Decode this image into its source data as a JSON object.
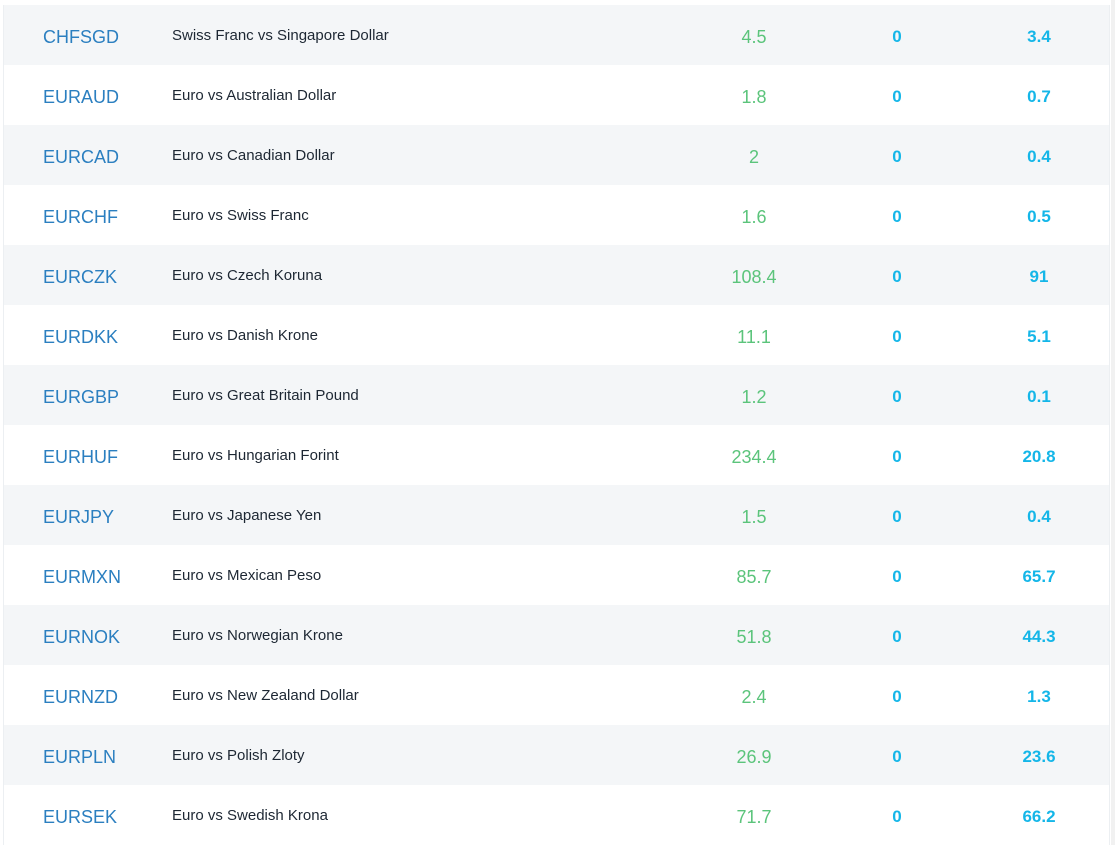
{
  "rows": [
    {
      "symbol": "CHFSGD",
      "description": "Swiss Franc vs Singapore Dollar",
      "spread": "4.5",
      "col3": "0",
      "col4": "3.4"
    },
    {
      "symbol": "EURAUD",
      "description": "Euro vs Australian Dollar",
      "spread": "1.8",
      "col3": "0",
      "col4": "0.7"
    },
    {
      "symbol": "EURCAD",
      "description": "Euro vs Canadian Dollar",
      "spread": "2",
      "col3": "0",
      "col4": "0.4"
    },
    {
      "symbol": "EURCHF",
      "description": "Euro vs Swiss Franc",
      "spread": "1.6",
      "col3": "0",
      "col4": "0.5"
    },
    {
      "symbol": "EURCZK",
      "description": "Euro vs Czech Koruna",
      "spread": "108.4",
      "col3": "0",
      "col4": "91"
    },
    {
      "symbol": "EURDKK",
      "description": "Euro vs Danish Krone",
      "spread": "11.1",
      "col3": "0",
      "col4": "5.1"
    },
    {
      "symbol": "EURGBP",
      "description": "Euro vs Great Britain Pound",
      "spread": "1.2",
      "col3": "0",
      "col4": "0.1"
    },
    {
      "symbol": "EURHUF",
      "description": "Euro vs Hungarian Forint",
      "spread": "234.4",
      "col3": "0",
      "col4": "20.8"
    },
    {
      "symbol": "EURJPY",
      "description": "Euro vs Japanese Yen",
      "spread": "1.5",
      "col3": "0",
      "col4": "0.4"
    },
    {
      "symbol": "EURMXN",
      "description": "Euro vs Mexican Peso",
      "spread": "85.7",
      "col3": "0",
      "col4": "65.7"
    },
    {
      "symbol": "EURNOK",
      "description": "Euro vs Norwegian Krone",
      "spread": "51.8",
      "col3": "0",
      "col4": "44.3"
    },
    {
      "symbol": "EURNZD",
      "description": "Euro vs New Zealand Dollar",
      "spread": "2.4",
      "col3": "0",
      "col4": "1.3"
    },
    {
      "symbol": "EURPLN",
      "description": "Euro vs Polish Zloty",
      "spread": "26.9",
      "col3": "0",
      "col4": "23.6"
    },
    {
      "symbol": "EURSEK",
      "description": "Euro vs Swedish Krona",
      "spread": "71.7",
      "col3": "0",
      "col4": "66.2"
    }
  ],
  "colors": {
    "symbol": "#2b7fc0",
    "spread": "#5bc47b",
    "highlight": "#14b6e8",
    "row_alt": "#f4f6f8"
  }
}
